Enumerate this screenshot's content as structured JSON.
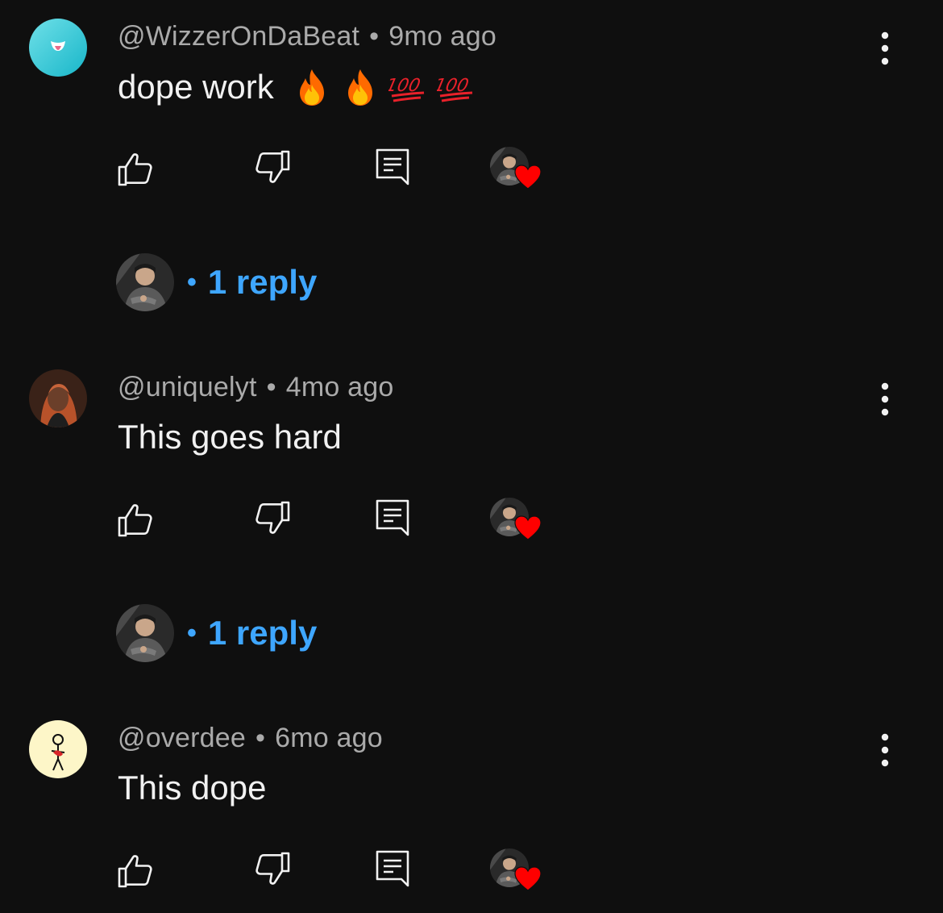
{
  "colors": {
    "background": "#0f0f0f",
    "text_primary": "#f1f1f1",
    "text_secondary": "#aaaaaa",
    "link_blue": "#3ea6ff",
    "heart_red": "#ff0000"
  },
  "icons": {
    "like": "thumb-up-icon",
    "dislike": "thumb-down-icon",
    "reply": "comment-icon",
    "more": "vertical-ellipsis-icon",
    "creator_heart": "heart-icon"
  },
  "separator": "•",
  "comments": [
    {
      "author": "@WizzerOnDaBeat",
      "time": "9mo ago",
      "text": "dope work",
      "emojis": [
        "fire",
        "fire",
        "hundred-points",
        "hundred-points"
      ],
      "replies_label": "1 reply"
    },
    {
      "author": "@uniquelyt",
      "time": "4mo ago",
      "text": "This goes hard",
      "emojis": [],
      "replies_label": "1 reply"
    },
    {
      "author": "@overdee",
      "time": "6mo ago",
      "text": "This dope",
      "emojis": []
    }
  ]
}
